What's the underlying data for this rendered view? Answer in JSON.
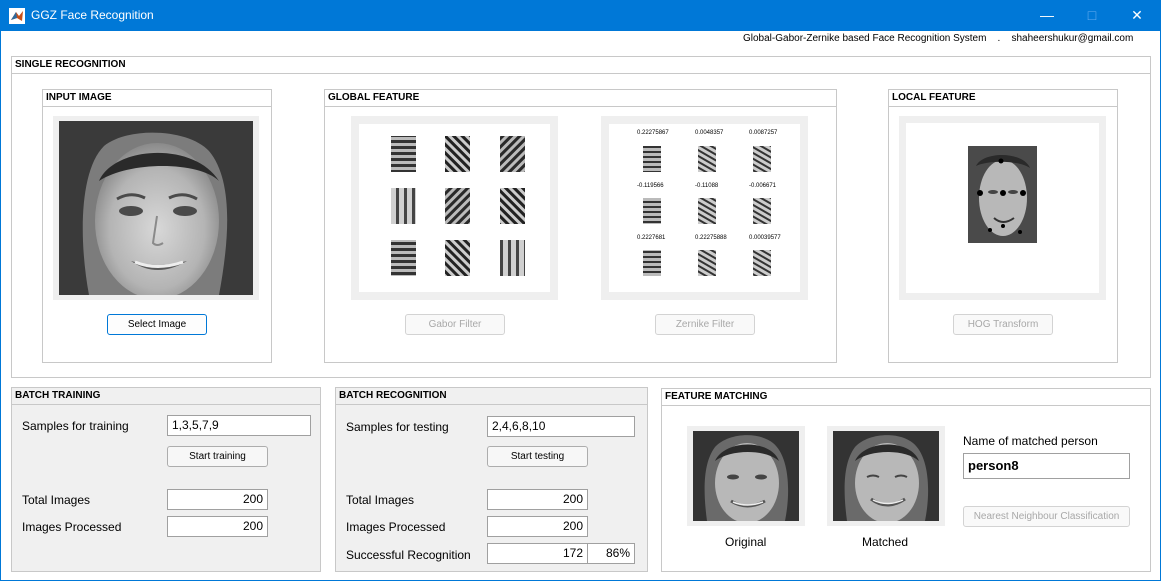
{
  "window": {
    "title": "GGZ Face Recognition",
    "min_glyph": "—",
    "max_glyph": "□",
    "close_glyph": "✕"
  },
  "header": {
    "info": "Global-Gabor-Zernike based Face Recognition System    .    shaheershukur@gmail.com"
  },
  "single": {
    "title": "SINGLE RECOGNITION",
    "input_image": {
      "title": "INPUT IMAGE",
      "button": "Select Image"
    },
    "global_feature": {
      "title": "GLOBAL FEATURE",
      "gabor_button": "Gabor Filter",
      "zernike_button": "Zernike Filter",
      "zernike_values": [
        "0.22275867",
        "0.0048357",
        "0.0087257",
        "-0.119566",
        "-0.11088",
        "-0.006671",
        "0.2227681",
        "0.22275888",
        "0.00039577"
      ]
    },
    "local_feature": {
      "title": "LOCAL FEATURE",
      "button": "HOG Transform"
    }
  },
  "batch_training": {
    "title": "BATCH TRAINING",
    "samples_label": "Samples for training",
    "samples_value": "1,3,5,7,9",
    "start_button": "Start training",
    "total_label": "Total Images",
    "total_value": "200",
    "processed_label": "Images Processed",
    "processed_value": "200"
  },
  "batch_recognition": {
    "title": "BATCH RECOGNITION",
    "samples_label": "Samples for testing",
    "samples_value": "2,4,6,8,10",
    "start_button": "Start testing",
    "total_label": "Total Images",
    "total_value": "200",
    "processed_label": "Images Processed",
    "processed_value": "200",
    "success_label": "Successful Recognition",
    "success_value": "172",
    "success_pct": "86%"
  },
  "feature_matching": {
    "title": "FEATURE MATCHING",
    "original_label": "Original",
    "matched_label": "Matched",
    "name_label": "Name of matched person",
    "name_value": "person8",
    "nn_button": "Nearest Neighbour Classification"
  },
  "colors": {
    "titlebar": "#0078d7",
    "primary_border": "#0078d7"
  }
}
